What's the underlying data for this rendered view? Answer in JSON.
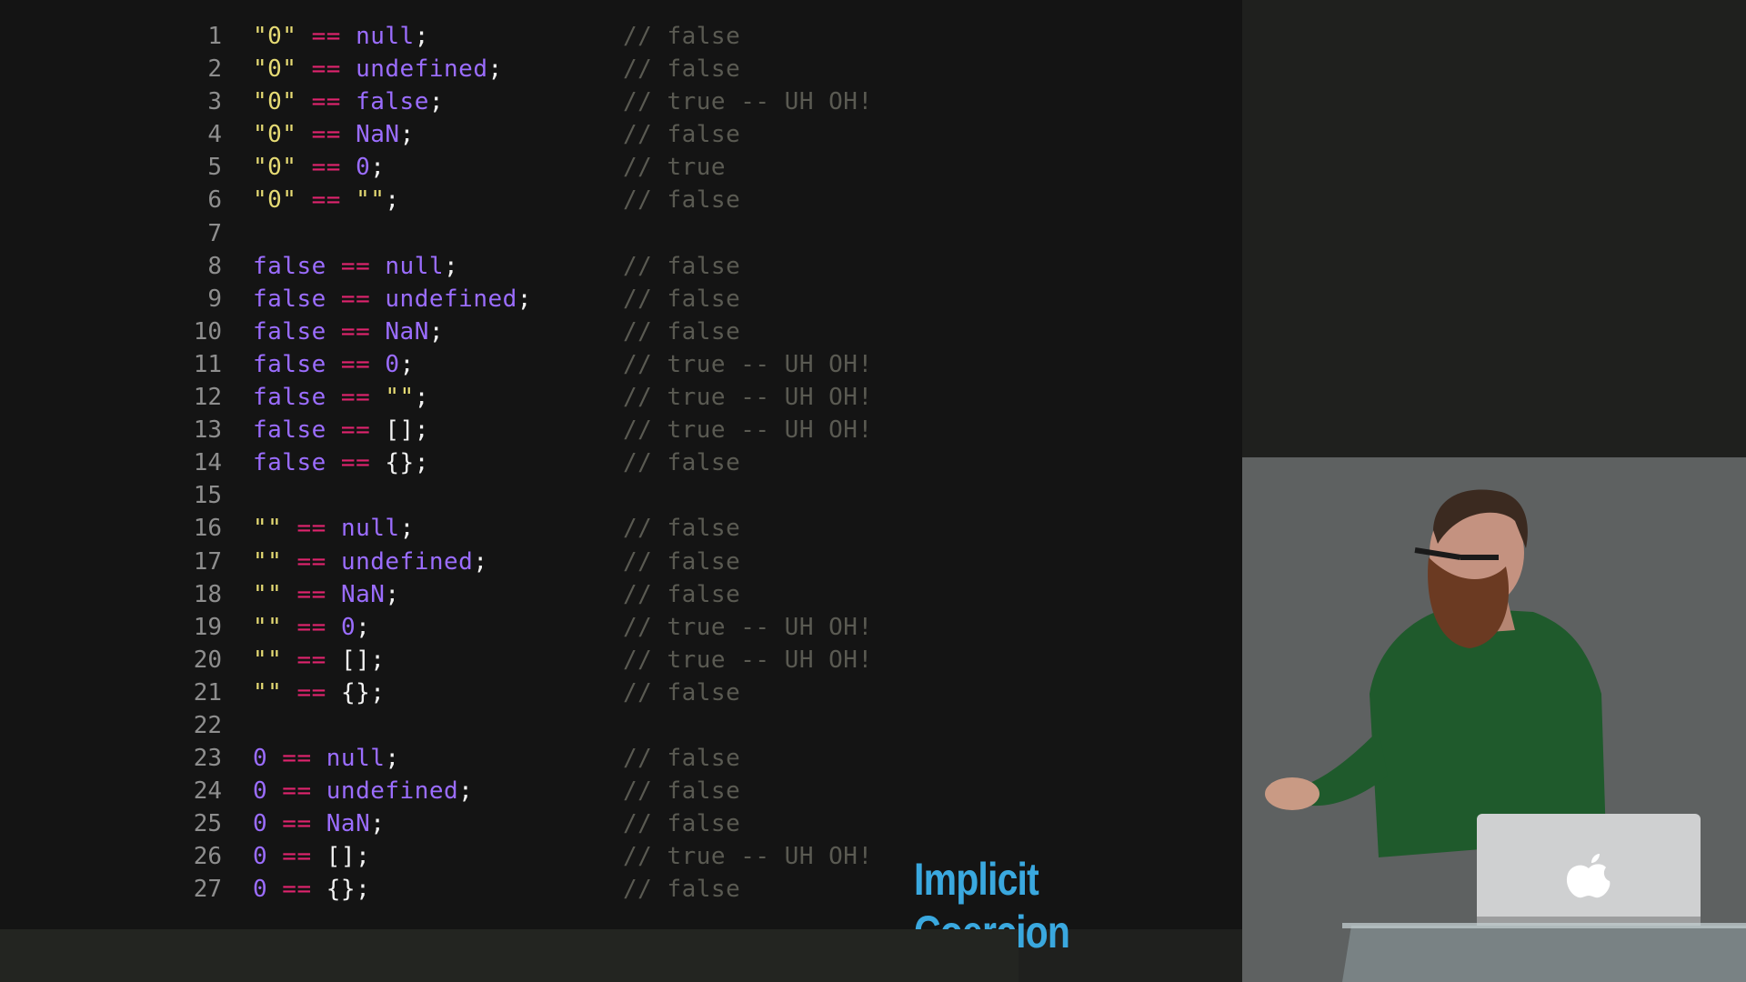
{
  "slide": {
    "title": "Implicit Coercion"
  },
  "code": {
    "lines": [
      {
        "n": "1",
        "tokens": [
          {
            "t": "\"0\"",
            "k": "str"
          },
          {
            "t": " == ",
            "k": "op"
          },
          {
            "t": "null",
            "k": "kw"
          },
          {
            "t": ";",
            "k": "punc"
          }
        ],
        "comment": "// false"
      },
      {
        "n": "2",
        "tokens": [
          {
            "t": "\"0\"",
            "k": "str"
          },
          {
            "t": " == ",
            "k": "op"
          },
          {
            "t": "undefined",
            "k": "kw"
          },
          {
            "t": ";",
            "k": "punc"
          }
        ],
        "comment": "// false"
      },
      {
        "n": "3",
        "tokens": [
          {
            "t": "\"0\"",
            "k": "str"
          },
          {
            "t": " == ",
            "k": "op"
          },
          {
            "t": "false",
            "k": "kw"
          },
          {
            "t": ";",
            "k": "punc"
          }
        ],
        "comment": "// true -- UH OH!"
      },
      {
        "n": "4",
        "tokens": [
          {
            "t": "\"0\"",
            "k": "str"
          },
          {
            "t": " == ",
            "k": "op"
          },
          {
            "t": "NaN",
            "k": "kw"
          },
          {
            "t": ";",
            "k": "punc"
          }
        ],
        "comment": "// false"
      },
      {
        "n": "5",
        "tokens": [
          {
            "t": "\"0\"",
            "k": "str"
          },
          {
            "t": " == ",
            "k": "op"
          },
          {
            "t": "0",
            "k": "num"
          },
          {
            "t": ";",
            "k": "punc"
          }
        ],
        "comment": "// true"
      },
      {
        "n": "6",
        "tokens": [
          {
            "t": "\"0\"",
            "k": "str"
          },
          {
            "t": " == ",
            "k": "op"
          },
          {
            "t": "\"\"",
            "k": "str"
          },
          {
            "t": ";",
            "k": "punc"
          }
        ],
        "comment": "// false"
      },
      {
        "n": "7",
        "tokens": [],
        "comment": ""
      },
      {
        "n": "8",
        "tokens": [
          {
            "t": "false",
            "k": "kw"
          },
          {
            "t": " == ",
            "k": "op"
          },
          {
            "t": "null",
            "k": "kw"
          },
          {
            "t": ";",
            "k": "punc"
          }
        ],
        "comment": "// false"
      },
      {
        "n": "9",
        "tokens": [
          {
            "t": "false",
            "k": "kw"
          },
          {
            "t": " == ",
            "k": "op"
          },
          {
            "t": "undefined",
            "k": "kw"
          },
          {
            "t": ";",
            "k": "punc"
          }
        ],
        "comment": "// false"
      },
      {
        "n": "10",
        "tokens": [
          {
            "t": "false",
            "k": "kw"
          },
          {
            "t": " == ",
            "k": "op"
          },
          {
            "t": "NaN",
            "k": "kw"
          },
          {
            "t": ";",
            "k": "punc"
          }
        ],
        "comment": "// false"
      },
      {
        "n": "11",
        "tokens": [
          {
            "t": "false",
            "k": "kw"
          },
          {
            "t": " == ",
            "k": "op"
          },
          {
            "t": "0",
            "k": "num"
          },
          {
            "t": ";",
            "k": "punc"
          }
        ],
        "comment": "// true -- UH OH!"
      },
      {
        "n": "12",
        "tokens": [
          {
            "t": "false",
            "k": "kw"
          },
          {
            "t": " == ",
            "k": "op"
          },
          {
            "t": "\"\"",
            "k": "str"
          },
          {
            "t": ";",
            "k": "punc"
          }
        ],
        "comment": "// true -- UH OH!"
      },
      {
        "n": "13",
        "tokens": [
          {
            "t": "false",
            "k": "kw"
          },
          {
            "t": " == ",
            "k": "op"
          },
          {
            "t": "[];",
            "k": "punc"
          }
        ],
        "comment": "// true -- UH OH!"
      },
      {
        "n": "14",
        "tokens": [
          {
            "t": "false",
            "k": "kw"
          },
          {
            "t": " == ",
            "k": "op"
          },
          {
            "t": "{};",
            "k": "punc"
          }
        ],
        "comment": "// false"
      },
      {
        "n": "15",
        "tokens": [],
        "comment": ""
      },
      {
        "n": "16",
        "tokens": [
          {
            "t": "\"\"",
            "k": "str"
          },
          {
            "t": " == ",
            "k": "op"
          },
          {
            "t": "null",
            "k": "kw"
          },
          {
            "t": ";",
            "k": "punc"
          }
        ],
        "comment": "// false"
      },
      {
        "n": "17",
        "tokens": [
          {
            "t": "\"\"",
            "k": "str"
          },
          {
            "t": " == ",
            "k": "op"
          },
          {
            "t": "undefined",
            "k": "kw"
          },
          {
            "t": ";",
            "k": "punc"
          }
        ],
        "comment": "// false"
      },
      {
        "n": "18",
        "tokens": [
          {
            "t": "\"\"",
            "k": "str"
          },
          {
            "t": " == ",
            "k": "op"
          },
          {
            "t": "NaN",
            "k": "kw"
          },
          {
            "t": ";",
            "k": "punc"
          }
        ],
        "comment": "// false"
      },
      {
        "n": "19",
        "tokens": [
          {
            "t": "\"\"",
            "k": "str"
          },
          {
            "t": " == ",
            "k": "op"
          },
          {
            "t": "0",
            "k": "num"
          },
          {
            "t": ";",
            "k": "punc"
          }
        ],
        "comment": "// true -- UH OH!"
      },
      {
        "n": "20",
        "tokens": [
          {
            "t": "\"\"",
            "k": "str"
          },
          {
            "t": " == ",
            "k": "op"
          },
          {
            "t": "[];",
            "k": "punc"
          }
        ],
        "comment": "// true -- UH OH!"
      },
      {
        "n": "21",
        "tokens": [
          {
            "t": "\"\"",
            "k": "str"
          },
          {
            "t": " == ",
            "k": "op"
          },
          {
            "t": "{};",
            "k": "punc"
          }
        ],
        "comment": "// false"
      },
      {
        "n": "22",
        "tokens": [],
        "comment": ""
      },
      {
        "n": "23",
        "tokens": [
          {
            "t": "0",
            "k": "num"
          },
          {
            "t": " == ",
            "k": "op"
          },
          {
            "t": "null",
            "k": "kw"
          },
          {
            "t": ";",
            "k": "punc"
          }
        ],
        "comment": "// false"
      },
      {
        "n": "24",
        "tokens": [
          {
            "t": "0",
            "k": "num"
          },
          {
            "t": " == ",
            "k": "op"
          },
          {
            "t": "undefined",
            "k": "kw"
          },
          {
            "t": ";",
            "k": "punc"
          }
        ],
        "comment": "// false"
      },
      {
        "n": "25",
        "tokens": [
          {
            "t": "0",
            "k": "num"
          },
          {
            "t": " == ",
            "k": "op"
          },
          {
            "t": "NaN",
            "k": "kw"
          },
          {
            "t": ";",
            "k": "punc"
          }
        ],
        "comment": "// false"
      },
      {
        "n": "26",
        "tokens": [
          {
            "t": "0",
            "k": "num"
          },
          {
            "t": " == ",
            "k": "op"
          },
          {
            "t": "[];",
            "k": "punc"
          }
        ],
        "comment": "// true -- UH OH!"
      },
      {
        "n": "27",
        "tokens": [
          {
            "t": "0",
            "k": "num"
          },
          {
            "t": " == ",
            "k": "op"
          },
          {
            "t": "{};",
            "k": "punc"
          }
        ],
        "comment": "// false"
      }
    ]
  },
  "colors": {
    "string": "#e6db74",
    "operator": "#e0246e",
    "keyword": "#9b6dff",
    "punctuation": "#f2f2f2",
    "comment": "#5a5a52",
    "title": "#3aa8df",
    "code_background": "#141414"
  },
  "video": {
    "icon": "apple-logo-icon"
  }
}
